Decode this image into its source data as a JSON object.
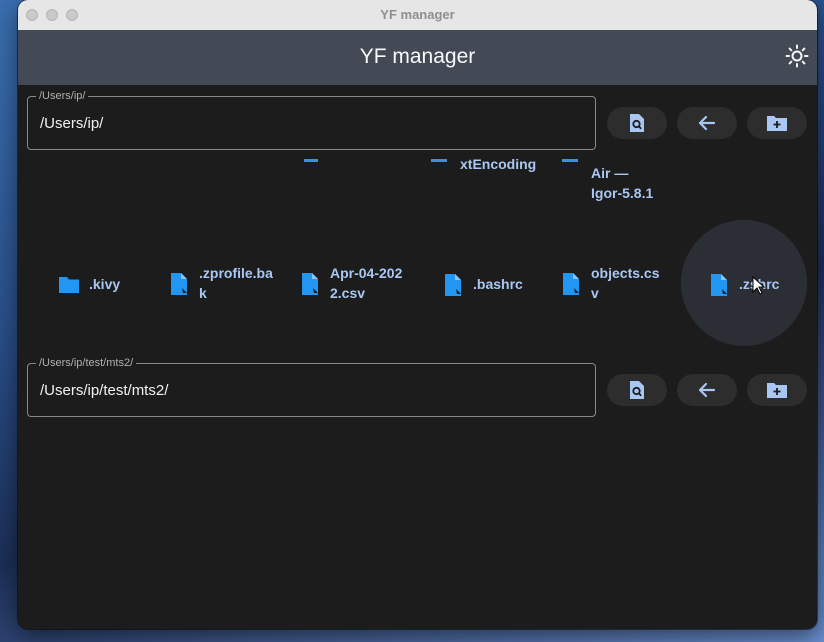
{
  "window": {
    "title": "YF manager"
  },
  "appbar": {
    "title": "YF manager",
    "theme_icon": "sun-icon"
  },
  "top_panel": {
    "path_label": "/Users/ip/",
    "path_value": "/Users/ip/",
    "buttons": [
      "search-file-icon",
      "arrow-left-icon",
      "folder-plus-icon"
    ]
  },
  "files_partial": [
    {
      "name": "xtEncoding"
    },
    {
      "name_line1": "Air —",
      "name_line2": "Igor-5.8.1"
    }
  ],
  "files": [
    {
      "name": ".kivy",
      "type": "folder"
    },
    {
      "name": ".zprofile.bak",
      "type": "file"
    },
    {
      "name": "Apr-04-2022.csv",
      "type": "file"
    },
    {
      "name": ".bashrc",
      "type": "file"
    },
    {
      "name": "objects.csv",
      "type": "file"
    },
    {
      "name": ".zshrc",
      "type": "file"
    }
  ],
  "bottom_panel": {
    "path_label": "/Users/ip/test/mts2/",
    "path_value": "/Users/ip/test/mts2/"
  },
  "colors": {
    "accent": "#2196f3",
    "label_blue": "#a9c7f2",
    "appbar": "#444a55",
    "background": "#1c1c1c"
  }
}
